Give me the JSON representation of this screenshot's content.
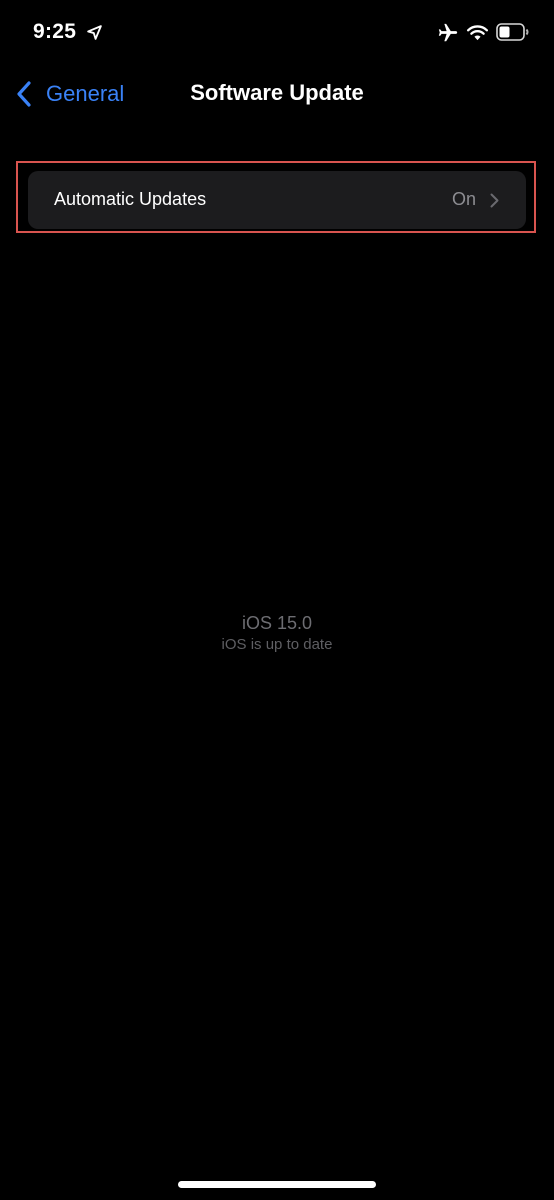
{
  "status_bar": {
    "time": "9:25",
    "icons": [
      "location-arrow-icon",
      "airplane-icon",
      "wifi-icon",
      "battery-icon"
    ]
  },
  "nav": {
    "back_label": "General",
    "title": "Software Update"
  },
  "settings": {
    "automatic_updates": {
      "label": "Automatic Updates",
      "value": "On"
    }
  },
  "version": {
    "title": "iOS 15.0",
    "status": "iOS is up to date"
  },
  "colors": {
    "background": "#000000",
    "row_background": "#1c1c1e",
    "accent": "#3a82f7",
    "highlight": "#d9544f",
    "secondary_text": "#8d8d92"
  }
}
